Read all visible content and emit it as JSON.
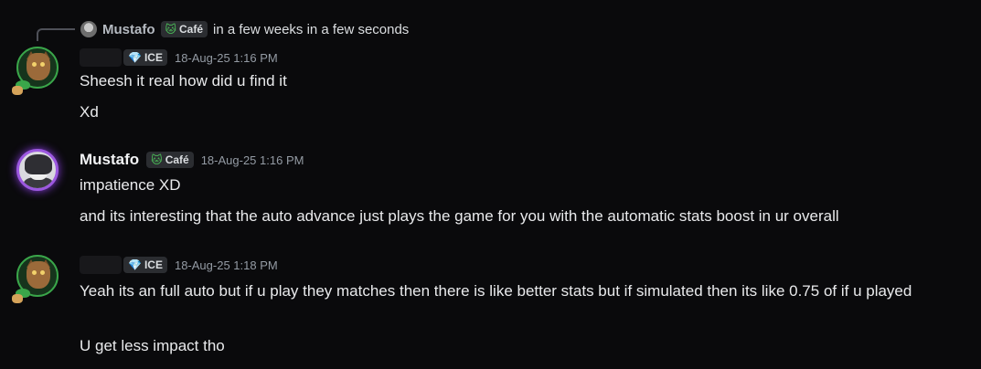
{
  "reply": {
    "username": "Mustafo",
    "badge": "Café",
    "text": "in a few weeks in a few seconds"
  },
  "messages": [
    {
      "username": "",
      "badge": "ICE",
      "timestamp": "18-Aug-25 1:16 PM",
      "lines": [
        "Sheesh it real how did u find it",
        "Xd"
      ]
    },
    {
      "username": "Mustafo",
      "badge": "Café",
      "timestamp": "18-Aug-25 1:16 PM",
      "lines": [
        "impatience XD",
        "and its interesting that the auto advance just plays the game for you with the automatic stats boost in ur overall"
      ]
    },
    {
      "username": "",
      "badge": "ICE",
      "timestamp": "18-Aug-25 1:18 PM",
      "lines": [
        "Yeah its an full auto but if u play they matches then there is like better stats but if simulated then its like 0.75 of if u played",
        "U get less impact tho"
      ]
    }
  ],
  "icons": {
    "ice_badge_icon": "diamond-icon",
    "cafe_badge_icon": "cat-icon"
  },
  "colors": {
    "background": "#0a0a0c",
    "username": "#f2f3f5",
    "timestamp": "#949ba4",
    "diamond": "#6fd0ff",
    "cafe_badge": "#4dc35a"
  }
}
